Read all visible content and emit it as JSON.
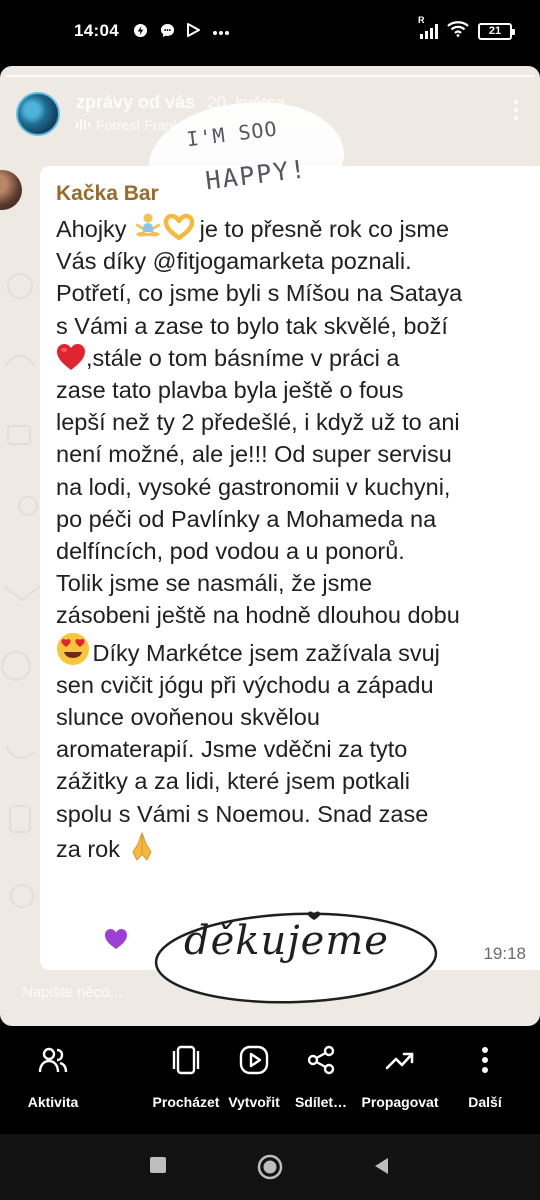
{
  "status_bar": {
    "time": "14:04",
    "battery_level": "21",
    "network_label": "R",
    "icons": [
      "data-saver-icon",
      "messenger-chat-icon",
      "play-store-icon",
      "more-notifications-icon",
      "signal-icon",
      "wifi-icon",
      "battery-icon"
    ]
  },
  "story": {
    "username": "zprávy od vás",
    "date": "20. května",
    "music": "Forrest Frank · Thank You",
    "sticker_happy": {
      "line1": "I'M SOO",
      "line2": "HAPPY!"
    },
    "sticker_dekujeme": "děkujeme",
    "reply_placeholder": "Napište něco..."
  },
  "message": {
    "sender": "Kačka Bar",
    "text_part1": "Ahojky ",
    "text_part2": " je to přesně rok co jsme\nVás díky @fitjogamarketa poznali.\nPotřetí, co jsme byli s Míšou na Sataya\ns Vámi a zase to bylo tak skvělé, boží\n",
    "text_part3": ",stále o tom  básníme v práci a\nzase tato plavba  byla  ještě o fous\nlepší než ty 2 předešlé, i když už to ani\nnení možné, ale je!!! Od super servisu\nna lodi, vysoké gastronomii  v kuchyni,\npo péči od Pavlínky a Mohameda na\ndelfíncích, pod vodou  a u ponorů.\nTolik jsme se nasmáli, že jsme\nzásobeni ještě na hodně dlouhou dobu\n",
    "text_part4": "  Díky Markétce jsem zažívala svuj\nsen cvičit jógu při východu a západu\nslunce ovoňenou skvělou\naromaterapií.  Jsme vděčni za tyto\nzážitky a za lidi, které jsem potkali\nspolu s Vámi  s Noemou. Snad zase\nza rok ",
    "time": "19:18",
    "emojis": [
      "person-in-lotus-position-emoji",
      "heart-hands-emoji",
      "red-heart-emoji",
      "heart-eyes-emoji",
      "folded-hands-emoji"
    ]
  },
  "toolbar": {
    "items": [
      {
        "label": "Aktivita",
        "icon": "activity-icon"
      },
      {
        "label": "Procházet",
        "icon": "browse-icon"
      },
      {
        "label": "Vytvořit",
        "icon": "create-icon"
      },
      {
        "label": "Sdílet…",
        "icon": "share-icon"
      },
      {
        "label": "Propagovat",
        "icon": "promote-icon"
      },
      {
        "label": "Další",
        "icon": "more-vertical-icon"
      }
    ]
  },
  "colors": {
    "sender_name": "#9a6b2b",
    "chat_background": "#eeeae3",
    "bubble": "#ffffff",
    "toolbar_bg": "#000000"
  }
}
